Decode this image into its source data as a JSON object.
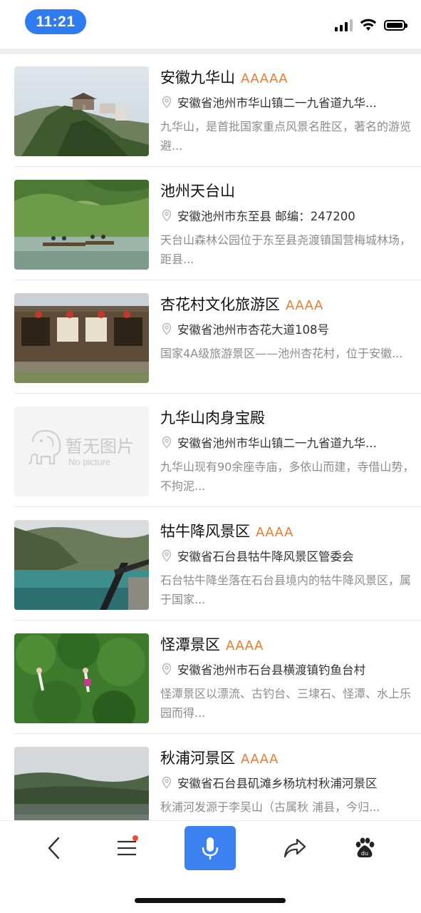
{
  "status_bar": {
    "time": "11:21"
  },
  "colors": {
    "accent": "#3b82f0",
    "rating": "#ef7b2a",
    "notification_dot": "#f04a3b"
  },
  "items": [
    {
      "title": "安徽九华山",
      "rating": "AAAAA",
      "address": "安徽省池州市华山镇二一九省道九华...",
      "description": "九华山，是首批国家重点风景名胜区，著名的游览避..."
    },
    {
      "title": "池州天台山",
      "rating": "",
      "address": "安徽池州市东至县 邮编：247200",
      "description": "天台山森林公园位于东至县尧渡镇国营梅城林场，距县..."
    },
    {
      "title": "杏花村文化旅游区",
      "rating": "AAAA",
      "address": "安徽省池州市杏花大道108号",
      "description": "国家4A级旅游景区——池州杏花村，位于安徽..."
    },
    {
      "title": "九华山肉身宝殿",
      "rating": "",
      "address": "安徽省池州市华山镇二一九省道九华...",
      "description": "九华山现有90余座寺庙，多依山而建，寺借山势，不拘泥...",
      "no_picture": {
        "zh": "暂无图片",
        "en": "No picture"
      }
    },
    {
      "title": "牯牛降风景区",
      "rating": "AAAA",
      "address": "安徽省石台县牯牛降风景区管委会",
      "description": "石台牯牛降坐落在石台县境内的牯牛降风景区，属于国家..."
    },
    {
      "title": "怪潭景区",
      "rating": "AAAA",
      "address": "安徽省池州市石台县横渡镇钓鱼台村",
      "description": "怪潭景区以漂流、古钓台、三埭石、怪潭、水上乐园而得..."
    },
    {
      "title": "秋浦河景区",
      "rating": "AAAA",
      "address": "安徽省石台县矶滩乡杨坑村秋浦河景区",
      "description": "秋浦河发源于李吴山（古属秋 浦县，今归..."
    }
  ],
  "toolbar": {
    "icons": [
      "back-icon",
      "menu-icon",
      "mic-icon",
      "share-icon",
      "baidu-paw-icon"
    ]
  }
}
